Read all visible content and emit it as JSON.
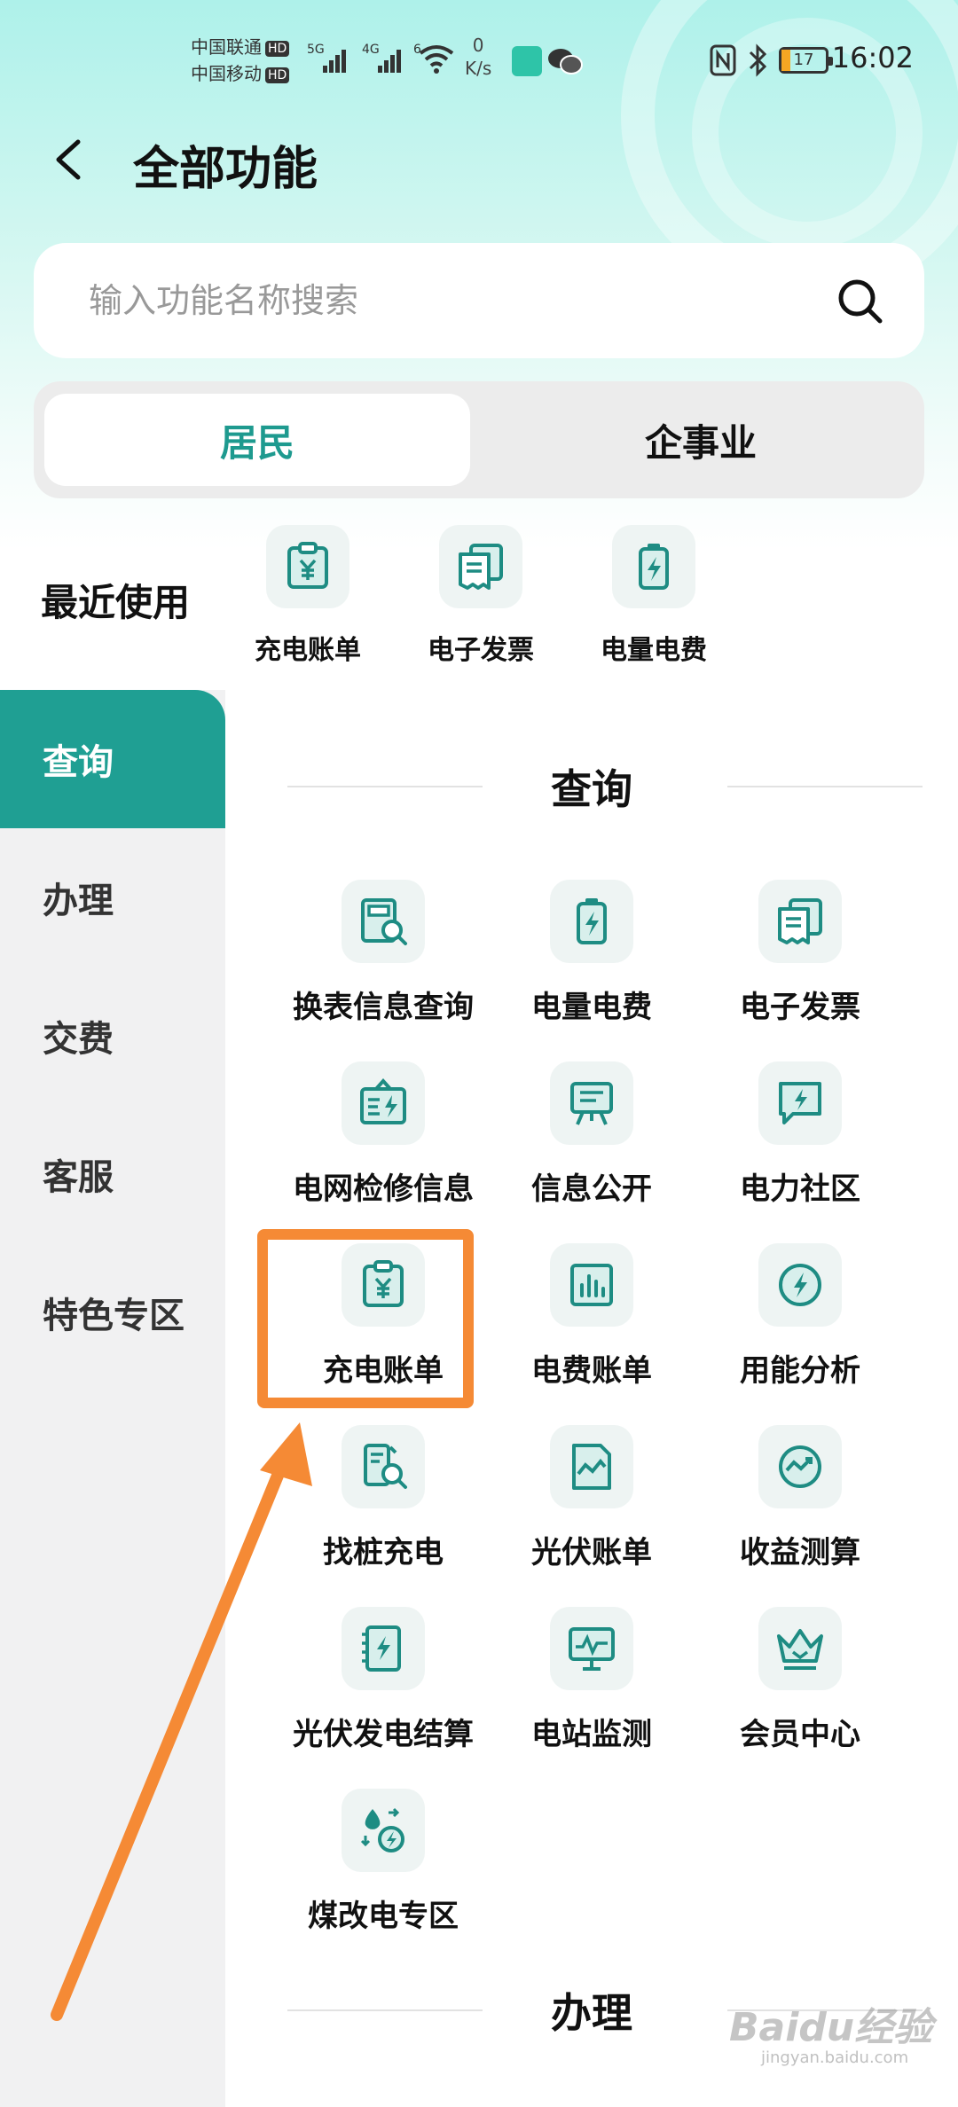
{
  "status_bar": {
    "carrier1": "中国联通",
    "carrier2": "中国移动",
    "hd": "HD",
    "net1": "5G",
    "net2": "4G",
    "net3": "6",
    "speed_value": "0",
    "speed_unit": "K/s",
    "battery": "17",
    "time": "16:02"
  },
  "header": {
    "title": "全部功能"
  },
  "search": {
    "placeholder": "输入功能名称搜索"
  },
  "tabs": [
    {
      "label": "居民"
    },
    {
      "label": "企事业"
    }
  ],
  "recent": {
    "label": "最近使用",
    "items": [
      {
        "label": "充电账单",
        "icon": "charging-bill-icon"
      },
      {
        "label": "电子发票",
        "icon": "e-invoice-icon"
      },
      {
        "label": "电量电费",
        "icon": "battery-bolt-icon"
      }
    ]
  },
  "sidebar": {
    "items": [
      {
        "label": "查询"
      },
      {
        "label": "办理"
      },
      {
        "label": "交费"
      },
      {
        "label": "客服"
      },
      {
        "label": "特色专区"
      }
    ]
  },
  "sections": [
    {
      "title": "查询",
      "items": [
        {
          "label": "换表信息查询",
          "icon": "meter-search-icon"
        },
        {
          "label": "电量电费",
          "icon": "battery-bolt-icon"
        },
        {
          "label": "电子发票",
          "icon": "e-invoice-icon"
        },
        {
          "label": "电网检修信息",
          "icon": "grid-maintenance-icon"
        },
        {
          "label": "信息公开",
          "icon": "info-board-icon"
        },
        {
          "label": "电力社区",
          "icon": "community-chat-icon"
        },
        {
          "label": "充电账单",
          "icon": "charging-bill-icon"
        },
        {
          "label": "电费账单",
          "icon": "bar-chart-icon"
        },
        {
          "label": "用能分析",
          "icon": "energy-analysis-icon"
        },
        {
          "label": "找桩充电",
          "icon": "find-charger-icon"
        },
        {
          "label": "光伏账单",
          "icon": "pv-bill-icon"
        },
        {
          "label": "收益测算",
          "icon": "revenue-estimate-icon"
        },
        {
          "label": "光伏发电结算",
          "icon": "pv-settlement-icon"
        },
        {
          "label": "电站监测",
          "icon": "station-monitor-icon"
        },
        {
          "label": "会员中心",
          "icon": "crown-icon"
        },
        {
          "label": "煤改电专区",
          "icon": "coal-to-electric-icon"
        }
      ]
    },
    {
      "title": "办理",
      "items": []
    }
  ],
  "watermark": {
    "text": "Baidu经验",
    "sub": "jingyan.baidu.com"
  },
  "colors": {
    "accent": "#1f9f93",
    "highlight": "#f58a35",
    "icon": "#1e8c83",
    "tile": "#eef4f3"
  }
}
